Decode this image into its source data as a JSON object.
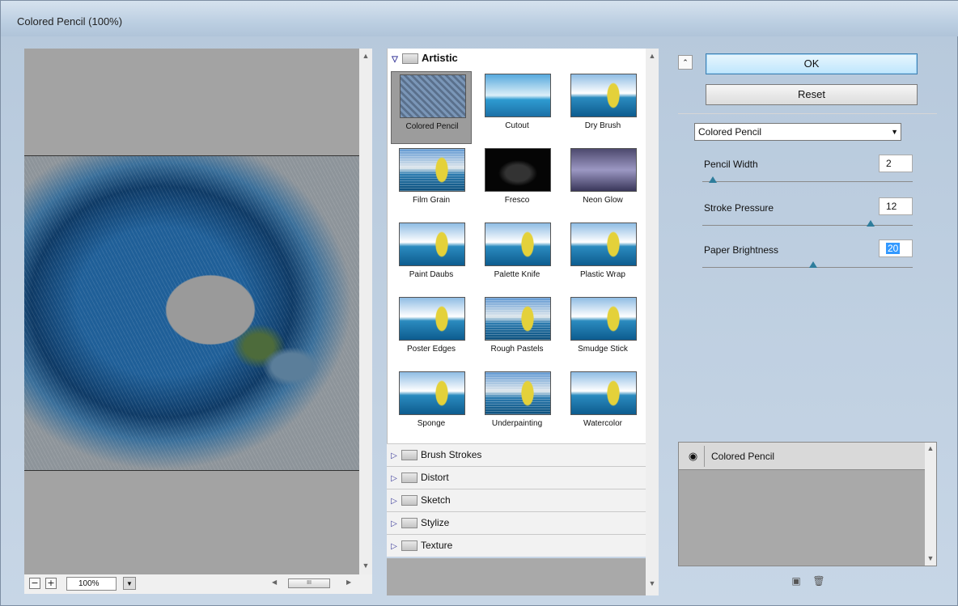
{
  "window": {
    "title": "Colored Pencil (100%)"
  },
  "preview": {
    "zoom": "100%",
    "zoom_out": "−",
    "zoom_in": "+",
    "scroll_thumb": "III"
  },
  "gallery": {
    "open_category": "Artistic",
    "filters": [
      {
        "label": "Colored Pencil",
        "selected": true
      },
      {
        "label": "Cutout"
      },
      {
        "label": "Dry Brush"
      },
      {
        "label": "Film Grain"
      },
      {
        "label": "Fresco"
      },
      {
        "label": "Neon Glow"
      },
      {
        "label": "Paint Daubs"
      },
      {
        "label": "Palette Knife"
      },
      {
        "label": "Plastic Wrap"
      },
      {
        "label": "Poster Edges"
      },
      {
        "label": "Rough Pastels"
      },
      {
        "label": "Smudge Stick"
      },
      {
        "label": "Sponge"
      },
      {
        "label": "Underpainting"
      },
      {
        "label": "Watercolor"
      }
    ],
    "categories": [
      "Brush Strokes",
      "Distort",
      "Sketch",
      "Stylize",
      "Texture"
    ]
  },
  "actions": {
    "ok": "OK",
    "reset": "Reset"
  },
  "settings": {
    "filter_select": "Colored Pencil",
    "params": [
      {
        "label": "Pencil Width",
        "value": "2",
        "level": 0.05
      },
      {
        "label": "Stroke Pressure",
        "value": "12",
        "level": 0.8
      },
      {
        "label": "Paper Brightness",
        "value": "20",
        "level": 0.4,
        "focused": true
      }
    ]
  },
  "layers": {
    "items": [
      {
        "name": "Colored Pencil",
        "visible": true
      }
    ]
  }
}
